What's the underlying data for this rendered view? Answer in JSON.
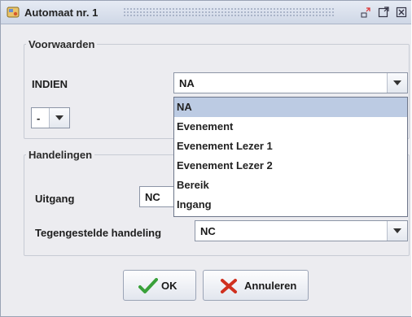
{
  "window": {
    "title": "Automaat nr. 1",
    "icon": "automaton-icon",
    "controls": {
      "minimize": "minimize-icon",
      "maximize": "maximize-icon",
      "close": "close-icon"
    }
  },
  "conditions": {
    "legend": "Voorwaarden",
    "if_label": "INDIEN",
    "if_value": "NA",
    "operator_value": "-",
    "dropdown_options": [
      "NA",
      "Evenement",
      "Evenement Lezer 1",
      "Evenement Lezer 2",
      "Bereik",
      "Ingang"
    ],
    "dropdown_selected": "NA"
  },
  "actions": {
    "legend": "Handelingen",
    "output_label": "Uitgang",
    "output_value": "NC",
    "inverse_label": "Tegengestelde handeling",
    "inverse_value": "NC"
  },
  "buttons": {
    "ok_label": "OK",
    "cancel_label": "Annuleren"
  },
  "colors": {
    "selection": "#bccbe3",
    "ok_check": "#3aa13a",
    "cancel_x": "#d0301f"
  }
}
